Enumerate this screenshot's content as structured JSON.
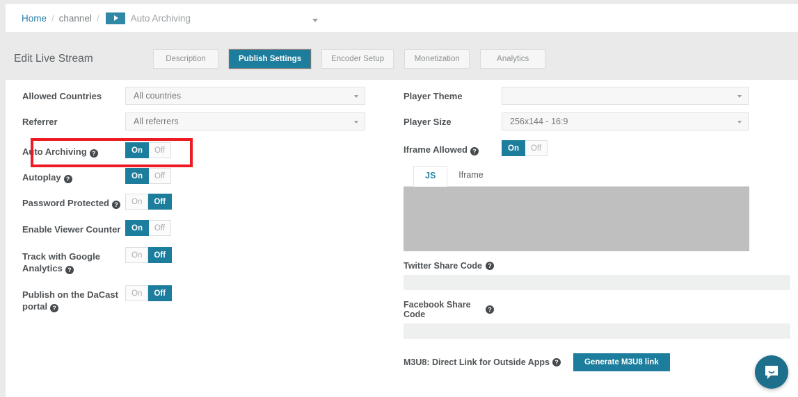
{
  "breadcrumb": {
    "home": "Home",
    "separator": "/",
    "channel": "channel",
    "current": "Auto Archiving",
    "play_icon": "play-icon",
    "caret_icon": "chevron-down-icon"
  },
  "header": {
    "title": "Edit Live Stream",
    "tabs": [
      {
        "label": "Description",
        "active": false
      },
      {
        "label": "Publish Settings",
        "active": true
      },
      {
        "label": "Encoder Setup",
        "active": false
      },
      {
        "label": "Monetization",
        "active": false
      },
      {
        "label": "Analytics",
        "active": false
      }
    ]
  },
  "left_column": {
    "allowed_countries": {
      "label": "Allowed Countries",
      "value": "All countries"
    },
    "referrer": {
      "label": "Referrer",
      "value": "All referrers"
    },
    "auto_archiving": {
      "label": "Auto Archiving",
      "state": "On",
      "on": "On",
      "off": "Off",
      "help": "?"
    },
    "autoplay": {
      "label": "Autoplay",
      "state": "On",
      "on": "On",
      "off": "Off",
      "help": "?"
    },
    "password_protected": {
      "label": "Password Protected",
      "state": "Off",
      "on": "On",
      "off": "Off",
      "help": "?"
    },
    "enable_viewer_counter": {
      "label": "Enable Viewer Counter",
      "state": "On",
      "on": "On",
      "off": "Off"
    },
    "track_google_analytics": {
      "label": "Track with Google Analytics",
      "state": "Off",
      "on": "On",
      "off": "Off",
      "help": "?"
    },
    "publish_dacast_portal": {
      "label": "Publish on the DaCast portal",
      "state": "Off",
      "on": "On",
      "off": "Off",
      "help": "?"
    }
  },
  "right_column": {
    "player_theme": {
      "label": "Player Theme",
      "value": ""
    },
    "player_size": {
      "label": "Player Size",
      "value": "256x144 - 16:9"
    },
    "iframe_allowed": {
      "label": "Iframe Allowed",
      "state": "On",
      "on": "On",
      "off": "Off",
      "help": "?"
    },
    "embed": {
      "tabs": [
        {
          "label": "JS",
          "active": true
        },
        {
          "label": "Iframe",
          "active": false
        }
      ],
      "code_value": ""
    },
    "twitter_share": {
      "label": "Twitter Share Code",
      "help": "?",
      "value": ""
    },
    "facebook_share": {
      "label": "Facebook Share Code",
      "help": "?",
      "value": ""
    },
    "m3u8": {
      "label": "M3U8: Direct Link for Outside Apps",
      "help": "?",
      "button": "Generate M3U8 link"
    }
  },
  "chat": {
    "icon": "chat-bubble-icon"
  },
  "colors": {
    "accent_teal": "#1c7d9c",
    "breadcrumb_link": "#2a7fa8",
    "highlight_red": "#ec1c24",
    "redaction_gray": "#bfbfbf"
  }
}
